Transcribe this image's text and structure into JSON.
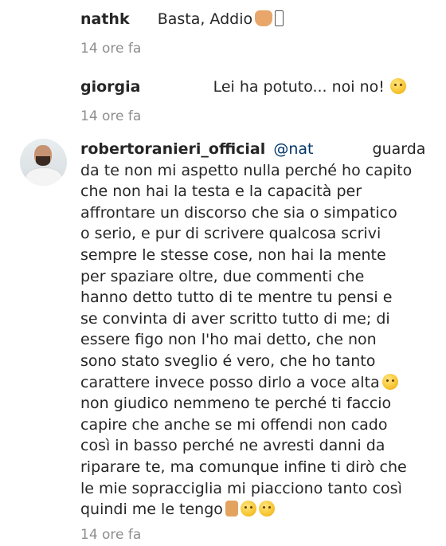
{
  "comments": [
    {
      "username": "nathk",
      "text": "Basta, Addio",
      "emojis": [
        "waving-hand-emoji",
        "missing-glyph"
      ],
      "time": "14 ore fa"
    },
    {
      "username": "giorgia",
      "text": "Lei ha potuto... noi no!",
      "emojis": [
        "weary-face-emoji"
      ],
      "time": "14 ore fa"
    },
    {
      "username": "robertoranieri_official",
      "mention": "@nat",
      "first_line_end": "guarda",
      "lines": [
        "da te non mi aspetto nulla perché ho capito",
        "che non hai la testa e la capacità per",
        "affrontare un discorso che sia o simpatico",
        "o serio, e pur di scrivere qualcosa scrivi",
        "sempre le stesse cose, non hai la mente",
        "per spaziare oltre, due commenti che",
        "hanno detto tutto di te mentre tu pensi e",
        "se convinta di aver scritto tutto di me; di",
        "essere figo non l'ho mai detto, che non",
        "sono stato sveglio é vero, che ho tanto",
        "carattere invece posso dirlo a voce alta",
        "non giudico nemmeno te perché ti faccio",
        "capire che anche se mi offendi non cado",
        "così in basso perché ne avresti danni da",
        "riparare te, ma comunque infine ti dirò che",
        "le mie sopracciglia mi piacciono tanto così",
        "quindi me le tengo"
      ],
      "time": "14 ore fa"
    }
  ]
}
